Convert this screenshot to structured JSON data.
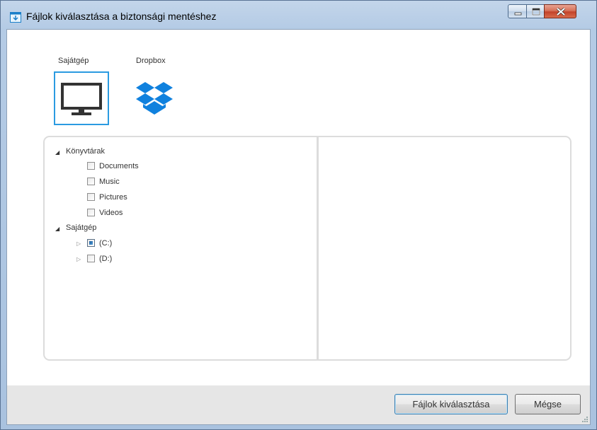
{
  "window": {
    "title": "Fájlok kiválasztása a biztonsági mentéshez"
  },
  "sources": [
    {
      "label": "Sajátgép",
      "icon": "monitor-icon",
      "selected": true
    },
    {
      "label": "Dropbox",
      "icon": "dropbox-icon",
      "selected": false
    }
  ],
  "tree": {
    "libraries": {
      "label": "Könyvtárak",
      "items": [
        "Documents",
        "Music",
        "Pictures",
        "Videos"
      ]
    },
    "computer": {
      "label": "Sajátgép",
      "drives": [
        {
          "label": "(C:)",
          "state": "partial"
        },
        {
          "label": "(D:)",
          "state": "unchecked"
        }
      ]
    }
  },
  "footer": {
    "select_label": "Fájlok kiválasztása",
    "cancel_label": "Mégse"
  },
  "colors": {
    "accent": "#2b9be1",
    "dropbox": "#1081de",
    "frame": "#b4cbe5"
  }
}
